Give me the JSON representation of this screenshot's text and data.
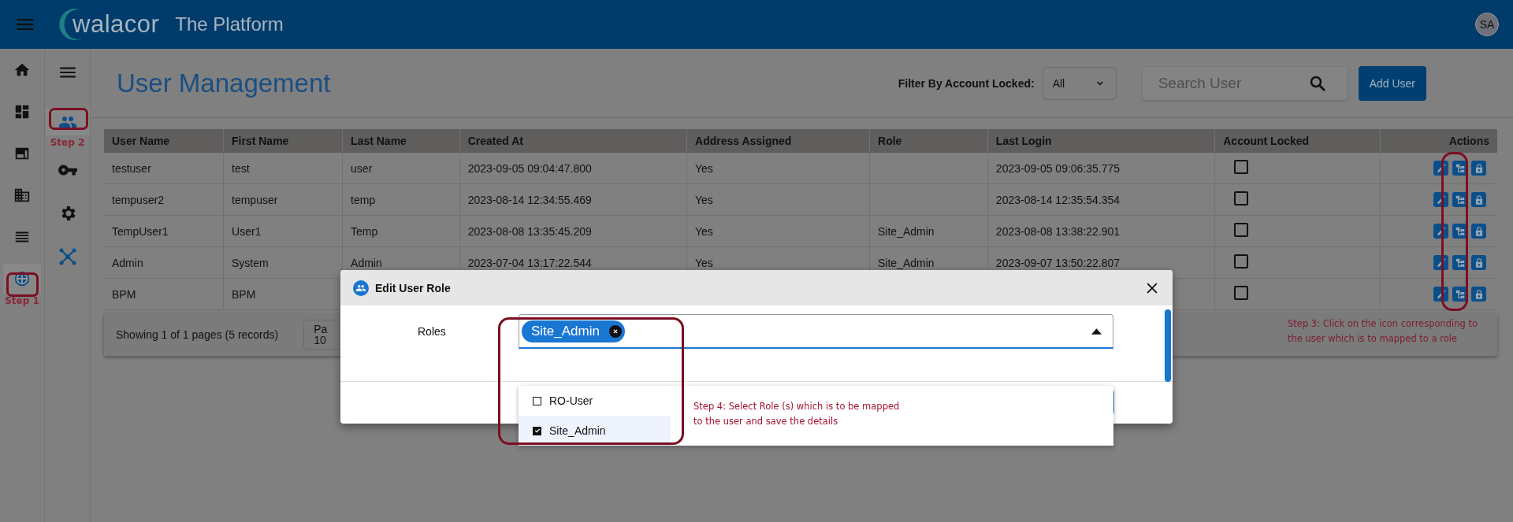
{
  "app_bar": {
    "logo": "walacor",
    "title": "The Platform",
    "avatar": "SA"
  },
  "nav_rail": [
    {
      "kind": "home",
      "selected": false
    },
    {
      "kind": "dashboard",
      "selected": false
    },
    {
      "kind": "window",
      "selected": false
    },
    {
      "kind": "building",
      "selected": false
    },
    {
      "kind": "list",
      "selected": false
    },
    {
      "kind": "globe",
      "selected": true,
      "note": "Step 1"
    }
  ],
  "sub_nav": [
    {
      "kind": "menu",
      "selected": false
    },
    {
      "kind": "users",
      "selected": true,
      "note": "Step 2"
    },
    {
      "kind": "key",
      "selected": false
    },
    {
      "kind": "gear",
      "selected": false
    },
    {
      "kind": "network",
      "selected": false
    }
  ],
  "page": {
    "title": "User Management",
    "filter": {
      "label": "Filter By Account Locked:",
      "value": "All"
    },
    "search": {
      "placeholder": "Search User"
    },
    "add_button": "Add User"
  },
  "table": {
    "columns": [
      "User Name",
      "First Name",
      "Last Name",
      "Created At",
      "Address Assigned",
      "Role",
      "Last Login",
      "Account Locked",
      "Actions"
    ],
    "rows": [
      {
        "cells": [
          "testuser",
          "test",
          "user",
          "2023-09-05 09:04:47.800",
          "Yes",
          "",
          "2023-09-05 09:06:35.775"
        ],
        "account_locked": false
      },
      {
        "cells": [
          "tempuser2",
          "tempuser",
          "temp",
          "2023-08-14 12:34:55.469",
          "Yes",
          "",
          "2023-08-14 12:35:54.354"
        ],
        "account_locked": false
      },
      {
        "cells": [
          "TempUser1",
          "User1",
          "Temp",
          "2023-08-08 13:35:45.209",
          "Yes",
          "Site_Admin",
          "2023-08-08 13:38:22.901"
        ],
        "account_locked": false
      },
      {
        "cells": [
          "Admin",
          "System",
          "Admin",
          "2023-07-04 13:17:22.544",
          "Yes",
          "Site_Admin",
          "2023-09-07 13:50:22.807"
        ],
        "account_locked": false
      },
      {
        "cells": [
          "BPM",
          "BPM"
        ],
        "account_locked": false
      }
    ],
    "note": "Step 3: Click on the icon corresponding to the user which is to mapped to a role"
  },
  "pagination": {
    "summary": "Showing 1 of 1 pages (5 records)",
    "page_size_label": "Pa",
    "page_size": "10"
  },
  "dialog": {
    "title": "Edit User Role",
    "field_label": "Roles",
    "chips": [
      "Site_Admin"
    ],
    "options": [
      {
        "label": "RO-User",
        "checked": false,
        "selected": false
      },
      {
        "label": "Site_Admin",
        "checked": true,
        "selected": true
      }
    ],
    "note": "Step 4: Select Role (s) which is to be mapped to the user and save the details"
  }
}
